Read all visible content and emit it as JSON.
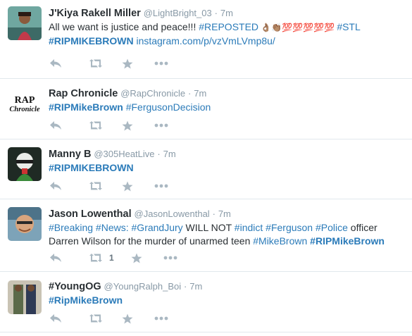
{
  "tweets": [
    {
      "name": "J'Kiya Rakell Miller",
      "handle": "@LightBright_03",
      "time": "7m",
      "text_plain1": "All we want is justice and peace!!! ",
      "tag_reposted": "#REPOSTED",
      "emoji1": " 👌🏽👏🏽💯💯💯💯💯 ",
      "tag_stl": "#STL",
      "tag_rip": "#RIPMIKEBROWN",
      "link": " instagram.com/p/vzVmLVmp8u/"
    },
    {
      "name": "Rap Chronicle",
      "handle": "@RapChronicle",
      "time": "7m",
      "tag_rip": "#RIPMikeBrown",
      "tag_ferguson": " #FergusonDecision",
      "avatar_text_top": "RAP",
      "avatar_text_bottom": "Chronicle"
    },
    {
      "name": "Manny B",
      "handle": "@305HeatLive",
      "time": "7m",
      "tag_rip": "#RIPMIKEBROWN"
    },
    {
      "name": "Jason Lowenthal",
      "handle": "@JasonLowenthal",
      "time": "7m",
      "tag_breaking": "#Breaking",
      "tag_news": " #News:",
      "tag_grandjury": " #GrandJury",
      "plain1": " WILL NOT ",
      "tag_indict": "#indict",
      "tag_ferguson": " #Ferguson",
      "tag_police": " #Police",
      "plain2": " officer Darren Wilson for the murder of unarmed teen ",
      "tag_mikebrown": "#MikeBrown",
      "tag_rip": " #RIPMikeBrown",
      "retweet_count": "1"
    },
    {
      "name": "#YoungOG",
      "handle": "@YoungRalph_Boi",
      "time": "7m",
      "tag_rip": "#RipMikeBrown"
    }
  ],
  "separator": "·",
  "icons": {
    "reply": "reply-icon",
    "retweet": "retweet-icon",
    "favorite": "star-icon",
    "more": "more-icon"
  },
  "colors": {
    "link": "#2b7bb9",
    "muted": "#8899a6",
    "action": "#aab8c2",
    "border": "#e1e8ed"
  }
}
